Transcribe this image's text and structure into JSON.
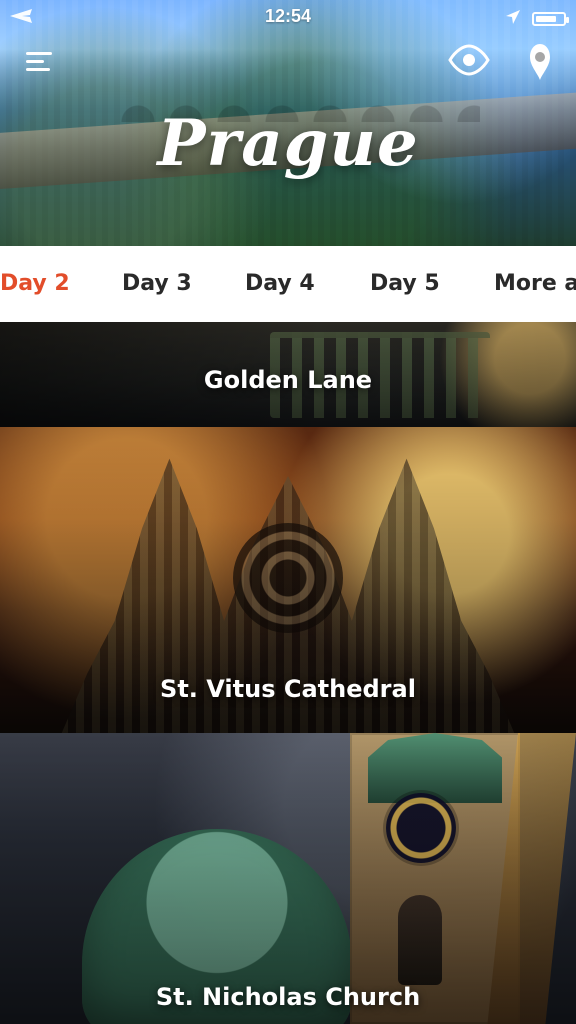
{
  "status_bar": {
    "time": "12:54",
    "left_icon": "airplane-icon",
    "right_icons": [
      "location-arrow-icon",
      "battery-icon"
    ]
  },
  "header": {
    "title": "Prague",
    "left_icon": "menu-icon",
    "right_icons": [
      "eye-icon",
      "map-pin-icon"
    ]
  },
  "tabs": [
    {
      "label": "Day 2",
      "active": true
    },
    {
      "label": "Day 3",
      "active": false
    },
    {
      "label": "Day 4",
      "active": false
    },
    {
      "label": "Day 5",
      "active": false
    },
    {
      "label": "More a",
      "active": false
    }
  ],
  "places": [
    {
      "name": "Golden Lane"
    },
    {
      "name": "St. Vitus Cathedral"
    },
    {
      "name": "St. Nicholas Church"
    }
  ],
  "colors": {
    "active_tab": "#e24d2a",
    "tab_text": "#2a2a2a",
    "tabs_background": "#ffffff",
    "overlay_text": "#ffffff"
  }
}
